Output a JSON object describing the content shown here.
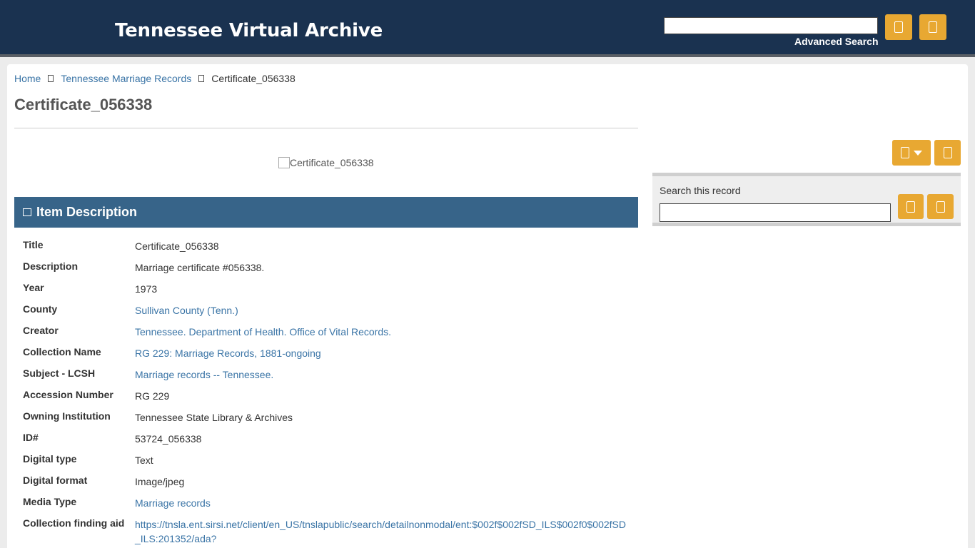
{
  "header": {
    "title": "Tennessee Virtual Archive",
    "search_value": "",
    "advanced_search": "Advanced Search"
  },
  "breadcrumb": {
    "home": "Home",
    "collection": "Tennessee Marriage Records",
    "current": "Certificate_056338"
  },
  "page_title": "Certificate_056338",
  "thumbnail_alt": "Certificate_056338",
  "item_description": {
    "heading": "Item Description",
    "fields": [
      {
        "label": "Title",
        "value": "Certificate_056338",
        "link": false
      },
      {
        "label": "Description",
        "value": "Marriage certificate #056338.",
        "link": false
      },
      {
        "label": "Year",
        "value": "1973",
        "link": false
      },
      {
        "label": "County",
        "value": "Sullivan County (Tenn.)",
        "link": true
      },
      {
        "label": "Creator",
        "value": "Tennessee. Department of Health. Office of Vital Records.",
        "link": true
      },
      {
        "label": "Collection Name",
        "value": "RG 229: Marriage Records, 1881-ongoing",
        "link": true
      },
      {
        "label": "Subject - LCSH",
        "value": "Marriage records -- Tennessee.",
        "link": true
      },
      {
        "label": "Accession Number",
        "value": "RG 229",
        "link": false
      },
      {
        "label": "Owning Institution",
        "value": "Tennessee State Library & Archives",
        "link": false
      },
      {
        "label": "ID#",
        "value": "53724_056338",
        "link": false
      },
      {
        "label": "Digital type",
        "value": "Text",
        "link": false
      },
      {
        "label": "Digital format",
        "value": "Image/jpeg",
        "link": false
      },
      {
        "label": "Media Type",
        "value": "Marriage records",
        "link": true
      },
      {
        "label": "Collection finding aid",
        "value": "https://tnsla.ent.sirsi.net/client/en_US/tnslapublic/search/detailnonmodal/ent:$002f$002fSD_ILS$002f0$002fSD_ILS:201352/ada?",
        "link": true
      }
    ]
  },
  "search_record": {
    "label": "Search this record",
    "value": ""
  },
  "colors": {
    "header_bg": "#1a3250",
    "accent": "#e8a832",
    "desc_header_bg": "#376489",
    "link": "#3a74a6"
  },
  "icons": {
    "header_search": "search-icon",
    "header_browse": "browse-icon",
    "tools_menu": "tools-icon",
    "tools_extra": "share-icon",
    "record_search": "search-icon",
    "record_clear": "clear-icon"
  }
}
